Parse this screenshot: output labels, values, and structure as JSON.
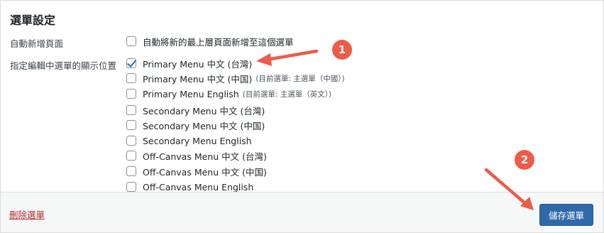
{
  "section_title": "選單設定",
  "auto_add": {
    "label": "自動新增頁面",
    "checkbox_label": "自動將新的最上層頁面新增至這個選單",
    "checked": false
  },
  "locations": {
    "label": "指定編輯中選單的顯示位置",
    "options": [
      {
        "label": "Primary Menu 中文 (台灣)",
        "note": "",
        "checked": true
      },
      {
        "label": "Primary Menu 中文 (中国)",
        "note": "(目前選單: 主選單（中國）)",
        "checked": false
      },
      {
        "label": "Primary Menu English",
        "note": "(目前選單: 主選單（英文）)",
        "checked": false
      },
      {
        "label": "Secondary Menu 中文 (台灣)",
        "note": "",
        "checked": false
      },
      {
        "label": "Secondary Menu 中文 (中国)",
        "note": "",
        "checked": false
      },
      {
        "label": "Secondary Menu English",
        "note": "",
        "checked": false
      },
      {
        "label": "Off-Canvas Menu 中文 (台灣)",
        "note": "",
        "checked": false
      },
      {
        "label": "Off-Canvas Menu 中文 (中国)",
        "note": "",
        "checked": false
      },
      {
        "label": "Off-Canvas Menu English",
        "note": "",
        "checked": false
      }
    ]
  },
  "footer": {
    "delete_label": "刪除選單",
    "save_label": "儲存選單"
  },
  "annotations": {
    "badge1": "1",
    "badge2": "2",
    "color": "#ed5b49"
  },
  "colors": {
    "primary_button": "#2f6aa8",
    "delete_link": "#b32d2e",
    "checkmark": "#2271b1"
  }
}
